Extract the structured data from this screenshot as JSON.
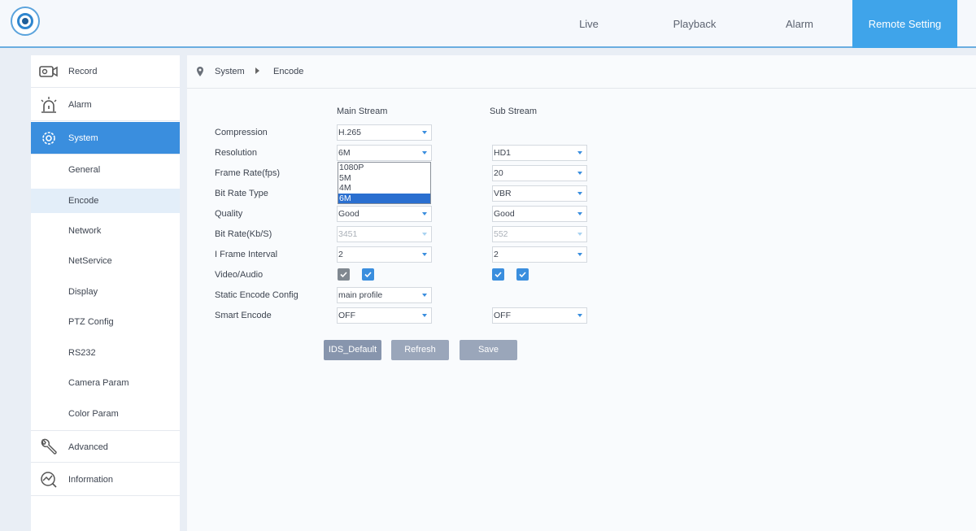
{
  "nav": {
    "items": [
      {
        "label": "Live"
      },
      {
        "label": "Playback"
      },
      {
        "label": "Alarm"
      },
      {
        "label": "Remote Setting"
      }
    ],
    "active": "Remote Setting"
  },
  "sidebar": {
    "main_items": [
      {
        "label": "Record",
        "icon": "camera-icon"
      },
      {
        "label": "Alarm",
        "icon": "siren-icon"
      },
      {
        "label": "System",
        "icon": "gear-icon"
      },
      {
        "label": "Advanced",
        "icon": "wrench-icon"
      },
      {
        "label": "Information",
        "icon": "activity-icon"
      }
    ],
    "sub_items": [
      {
        "label": "General"
      },
      {
        "label": "Encode"
      },
      {
        "label": "Network"
      },
      {
        "label": "NetService"
      },
      {
        "label": "Display"
      },
      {
        "label": "PTZ Config"
      },
      {
        "label": "RS232"
      },
      {
        "label": "Camera Param"
      },
      {
        "label": "Color Param"
      }
    ],
    "active_main": "System",
    "active_sub": "Encode"
  },
  "breadcrumb": {
    "section": "System",
    "page": "Encode"
  },
  "form": {
    "main_header": "Main Stream",
    "sub_header": "Sub Stream",
    "labels": {
      "compression": "Compression",
      "resolution": "Resolution",
      "frame_rate": "Frame Rate(fps)",
      "bit_rate_type": "Bit Rate Type",
      "quality": "Quality",
      "bit_rate": "Bit Rate(Kb/S)",
      "i_frame": "I Frame Interval",
      "video_audio": "Video/Audio",
      "static_encode": "Static Encode Config",
      "smart_encode": "Smart Encode"
    },
    "main": {
      "compression": "H.265",
      "resolution": "6M",
      "quality": "Good",
      "bit_rate": "3451",
      "i_frame": "2",
      "static_encode": "main profile",
      "smart_encode": "OFF",
      "video_checked": true,
      "audio_checked": true
    },
    "sub": {
      "resolution": "HD1",
      "frame_rate": "20",
      "bit_rate_type": "VBR",
      "quality": "Good",
      "bit_rate": "552",
      "i_frame": "2",
      "smart_encode": "OFF",
      "video_checked": true,
      "audio_checked": true
    },
    "resolution_options": [
      "1080P",
      "5M",
      "4M",
      "6M"
    ],
    "resolution_selected": "6M"
  },
  "buttons": {
    "default": "IDS_Default",
    "refresh": "Refresh",
    "save": "Save"
  },
  "colors": {
    "accent": "#3a8ede",
    "nav_active": "#3fa4ea",
    "button": "#9aa6ba"
  }
}
